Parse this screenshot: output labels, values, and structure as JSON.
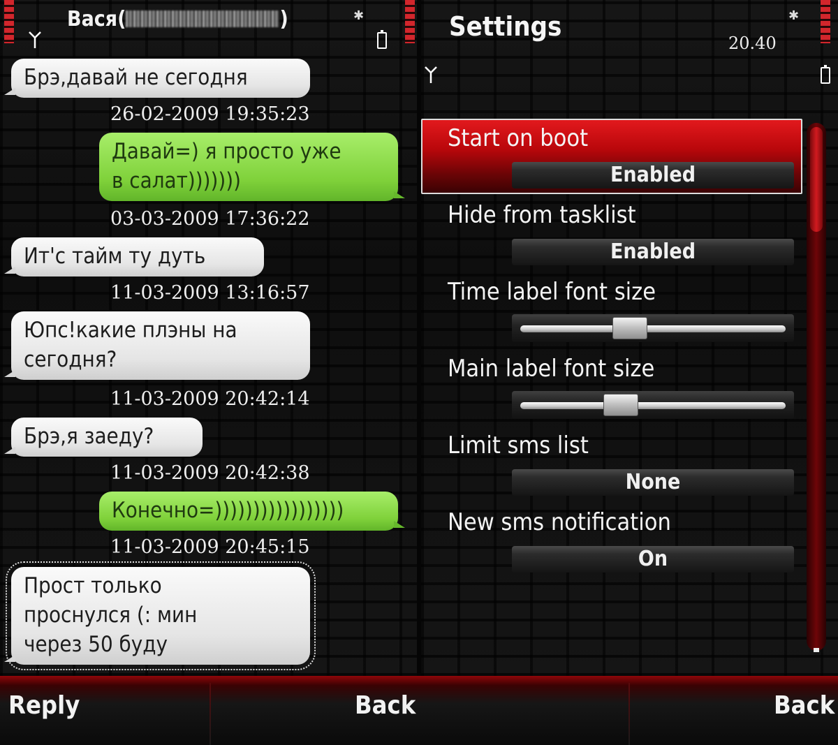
{
  "colors": {
    "highlight_red": "#c80b10",
    "incoming_bubble": "#e8e8e8",
    "outgoing_bubble": "#8ad448",
    "background": "#111111"
  },
  "conversation": {
    "contact_name": "Вася(",
    "contact_suffix": ")",
    "messages": [
      {
        "direction": "in",
        "text": "Брэ,давай не сегодня",
        "timestamp": "26-02-2009 19:35:23"
      },
      {
        "direction": "out",
        "lines": [
          "Давай=) я просто уже",
          "в салат)))))))"
        ],
        "timestamp": "03-03-2009 17:36:22"
      },
      {
        "direction": "in",
        "text": "Ит'с тайм ту дуть",
        "timestamp": "11-03-2009 13:16:57"
      },
      {
        "direction": "in",
        "lines": [
          "Юпс!какие плэны на",
          "сегодня?"
        ],
        "timestamp": "11-03-2009 20:42:14"
      },
      {
        "direction": "in",
        "text": "Брэ,я заеду?",
        "timestamp": "11-03-2009 20:42:38"
      },
      {
        "direction": "out",
        "text": "Конечно=)))))))))))))))))",
        "timestamp": "11-03-2009 20:45:15"
      },
      {
        "direction": "in",
        "lines": [
          "Прост только",
          "проснулся (: мин",
          "через 50 буду"
        ]
      }
    ]
  },
  "settings": {
    "title": "Settings",
    "clock": "20.40",
    "items": [
      {
        "label": "Start on boot",
        "value": "Enabled"
      },
      {
        "label": "Hide from tasklist",
        "value": "Enabled"
      },
      {
        "label": "Time label font size",
        "slider": 0.4
      },
      {
        "label": "Main label font size",
        "slider": 0.36
      },
      {
        "label": "Limit sms list",
        "value": "None"
      },
      {
        "label": "New sms notification",
        "value": "On"
      }
    ]
  },
  "softkeys": {
    "left": "Reply",
    "middle": "Back",
    "right": "Back"
  },
  "icons": [
    "antenna-icon",
    "bluetooth-icon",
    "battery-icon",
    "signal-strength-icon",
    "battery-level-icon"
  ]
}
